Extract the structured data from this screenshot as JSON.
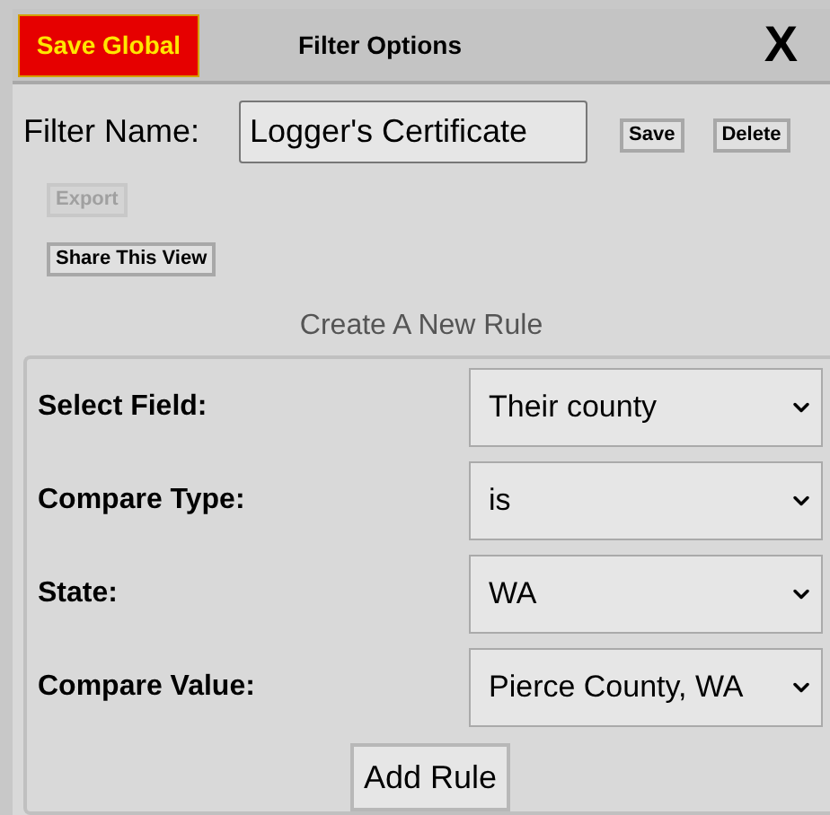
{
  "header": {
    "save_global": "Save Global",
    "title": "Filter Options",
    "close": "X"
  },
  "filter_name": {
    "label": "Filter Name:",
    "value": "Logger's Certificate",
    "save": "Save",
    "delete": "Delete"
  },
  "export": {
    "label": "Export",
    "disabled": true
  },
  "share": {
    "label": "Share This View",
    "disabled": false
  },
  "new_rule": {
    "heading": "Create A New Rule",
    "rows": [
      {
        "label": "Select Field:",
        "value": "Their county"
      },
      {
        "label": "Compare Type:",
        "value": "is"
      },
      {
        "label": "State:",
        "value": "WA"
      },
      {
        "label": "Compare Value:",
        "value": "Pierce County, WA"
      }
    ],
    "add_button": "Add Rule"
  }
}
